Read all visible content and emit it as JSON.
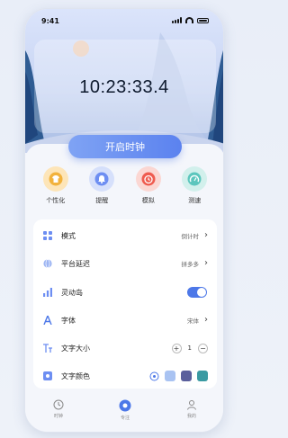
{
  "status_bar": {
    "time": "9:41"
  },
  "clock": {
    "time_text": "10:23:33.4"
  },
  "start_button": {
    "label": "开启时钟"
  },
  "features": [
    {
      "label": "个性化",
      "icon": "tshirt-icon",
      "color": "#f2b23c"
    },
    {
      "label": "提醒",
      "icon": "bell-icon",
      "color": "#6d8ef2"
    },
    {
      "label": "模拟",
      "icon": "clock-icon",
      "color": "#ef5b4f"
    },
    {
      "label": "测速",
      "icon": "speedometer-icon",
      "color": "#5cc6bd"
    }
  ],
  "settings": {
    "mode": {
      "label": "模式",
      "value": "倒计时"
    },
    "platform_delay": {
      "label": "平台延迟",
      "value": "拼多多"
    },
    "dynamic_island": {
      "label": "灵动岛",
      "enabled": true
    },
    "font": {
      "label": "字体",
      "value": "宋体"
    },
    "font_size": {
      "label": "文字大小",
      "value": "1",
      "plus": "+",
      "minus": "−"
    },
    "text_color": {
      "label": "文字颜色",
      "swatches": [
        "#a9c3f2",
        "#5a5f9c",
        "#3a9aa2"
      ]
    }
  },
  "tabbar": [
    {
      "label": "时钟",
      "icon": "clock-icon"
    },
    {
      "label": "专注",
      "icon": "focus-icon"
    },
    {
      "label": "我的",
      "icon": "profile-icon"
    }
  ],
  "colors": {
    "accent": "#4d78e8",
    "button_gradient_start": "#7fa3f4",
    "button_gradient_end": "#5b82ef"
  }
}
